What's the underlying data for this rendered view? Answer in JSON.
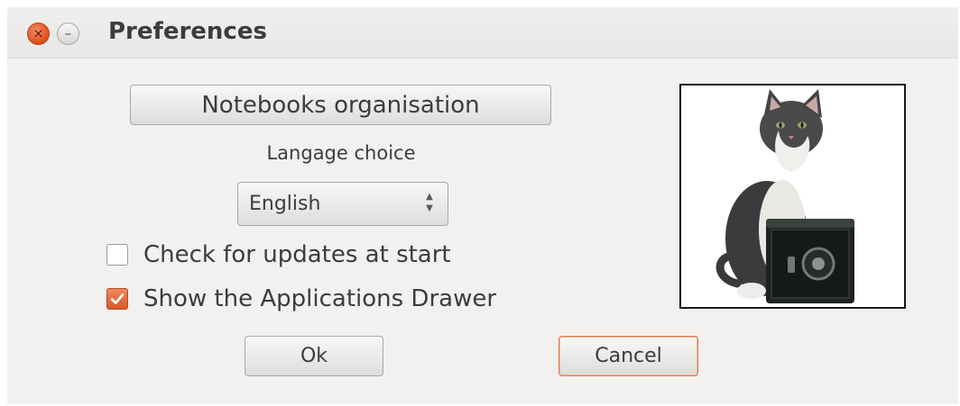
{
  "window": {
    "title": "Preferences",
    "close_glyph": "×",
    "minimize_glyph": "–"
  },
  "buttons": {
    "notebooks": "Notebooks organisation",
    "ok": "Ok",
    "cancel": "Cancel"
  },
  "language": {
    "label": "Langage choice",
    "selected": "English"
  },
  "checks": {
    "updates": {
      "label": "Check for updates at start",
      "checked": false
    },
    "drawer": {
      "label": "Show the Applications Drawer",
      "checked": true
    }
  },
  "icons": {
    "close": "close-icon",
    "minimize": "minimize-icon",
    "select_arrows": "up-down-arrows-icon",
    "checkmark": "checkmark-icon",
    "picture": "cat-on-safe-picture"
  },
  "colors": {
    "accent": "#e05a24",
    "window_bg": "#f2f1f0",
    "text": "#3c3c3c"
  }
}
